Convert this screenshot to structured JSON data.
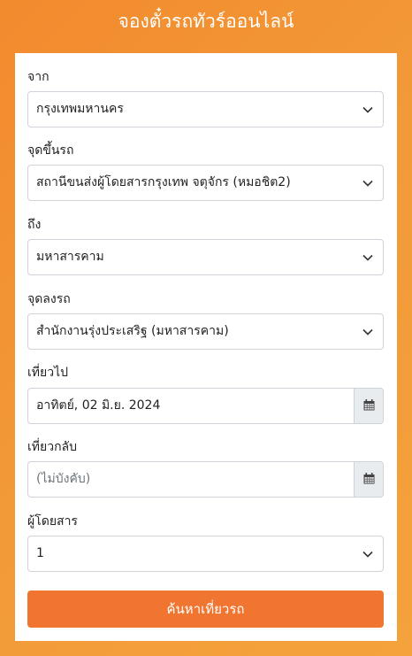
{
  "header": {
    "title": "จองตั๋วรถทัวร์ออนไลน์"
  },
  "form": {
    "from": {
      "label": "จาก",
      "value": "กรุงเทพมหานคร"
    },
    "boarding_point": {
      "label": "จุดขึ้นรถ",
      "value": "สถานีขนส่งผู้โดยสารกรุงเทพ จตุจักร (หมอชิต2)"
    },
    "to": {
      "label": "ถึง",
      "value": "มหาสารคาม"
    },
    "dropoff_point": {
      "label": "จุดลงรถ",
      "value": "สำนักงานรุ่งประเสริฐ (มหาสารคาม)"
    },
    "depart": {
      "label": "เที่ยวไป",
      "value": "อาทิตย์, 02 มิ.ย. 2024"
    },
    "return": {
      "label": "เที่ยวกลับ",
      "placeholder": "(ไม่บังคับ)"
    },
    "passengers": {
      "label": "ผู้โดยสาร",
      "value": "1"
    },
    "search_button": "ค้นหาเที่ยวรถ"
  },
  "icons": {
    "dropdown": "chevron-down-icon",
    "calendar": "calendar-icon"
  },
  "colors": {
    "background": "#f29a38",
    "button": "#ef7530",
    "addon_bg": "#e9ecef"
  }
}
